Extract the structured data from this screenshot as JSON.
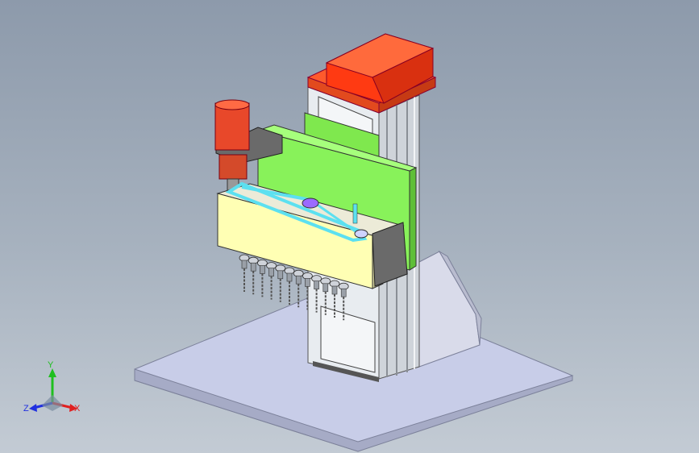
{
  "viewport": {
    "background_top": "#8d9aab",
    "background_bottom": "#c3cbd4"
  },
  "model": {
    "colors": {
      "motor_top": "#ff3a12",
      "motor_small": "#e8482a",
      "green_plate": "#88f25a",
      "cream_housing": "#ffffb4",
      "belt": "#5ce0f0",
      "base_plate": "#c8cde8",
      "column": "#e6eaee",
      "dark_block": "#6a6a6a"
    },
    "spindle_count": 12
  },
  "triad": {
    "y_label": "Y",
    "x_label": "X",
    "z_label": "Z",
    "y_color": "#1fbf1f",
    "x_color": "#e02020",
    "z_color": "#2030e0"
  }
}
